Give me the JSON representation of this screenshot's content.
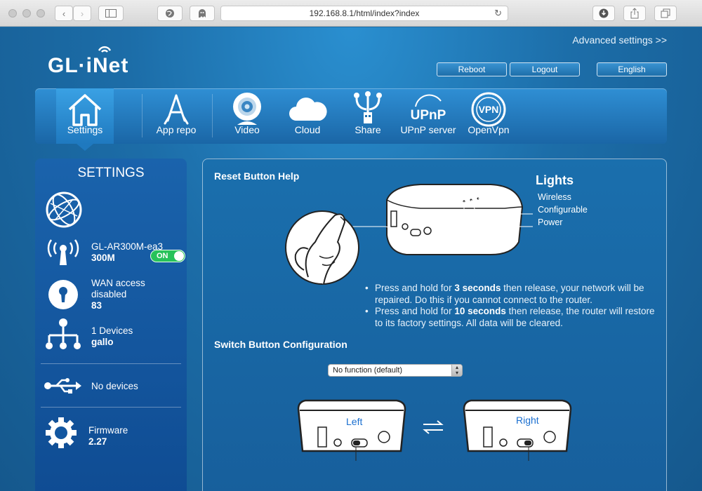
{
  "browser": {
    "url": "192.168.8.1/html/index?index"
  },
  "header": {
    "advanced_link": "Advanced settings >>",
    "logo_text": "GL·iNet",
    "buttons": {
      "reboot": "Reboot",
      "logout": "Logout",
      "language": "English"
    }
  },
  "nav": {
    "items": [
      {
        "label": "Settings",
        "icon": "home-icon",
        "active": true
      },
      {
        "label": "App repo",
        "icon": "app-store-icon",
        "active": false
      },
      {
        "label": "Video",
        "icon": "webcam-icon",
        "active": false
      },
      {
        "label": "Cloud",
        "icon": "cloud-icon",
        "active": false
      },
      {
        "label": "Share",
        "icon": "usb-share-icon",
        "active": false
      },
      {
        "label": "UPnP server",
        "icon": "upnp-icon",
        "active": false
      },
      {
        "label": "OpenVpn",
        "icon": "vpn-icon",
        "active": false
      }
    ],
    "upnp_icon_text": "UPnP",
    "vpn_icon_text": "VPN"
  },
  "sidebar": {
    "title": "SETTINGS",
    "wireless": {
      "name": "GL-AR300M-ea3",
      "speed": "300M",
      "toggle": "ON"
    },
    "wan": {
      "line1": "WAN access",
      "line2": "disabled",
      "count": "83"
    },
    "clients": {
      "line1": "1 Devices",
      "name": "gallo"
    },
    "usb": {
      "text": "No devices"
    },
    "firmware": {
      "label": "Firmware",
      "version": "2.27"
    }
  },
  "main": {
    "reset_title": "Reset Button Help",
    "lights": {
      "title": "Lights",
      "wireless": "Wireless",
      "configurable": "Configurable",
      "power": "Power"
    },
    "bullet1": {
      "pre": "Press and hold for ",
      "bold": "3 seconds",
      "post": " then release, your network will be repaired. Do this if you cannot connect to the router."
    },
    "bullet2": {
      "pre": "Press and hold for ",
      "bold": "10 seconds",
      "post": " then release, the router will restore to its factory settings. All data will be cleared."
    },
    "switch_title": "Switch Button Configuration",
    "switch_select": "No function (default)",
    "left_label": "Left",
    "right_label": "Right"
  }
}
